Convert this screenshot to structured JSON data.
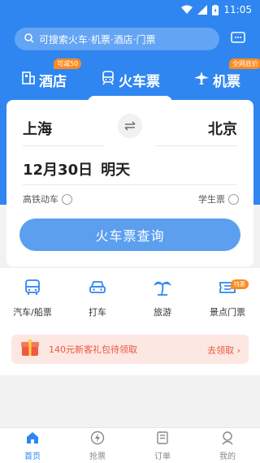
{
  "status": {
    "time": "11:05"
  },
  "search": {
    "placeholder": "可搜索火车·机票·酒店·门票"
  },
  "categories": [
    {
      "label": "酒店",
      "badge": "可减50"
    },
    {
      "label": "火车票"
    },
    {
      "label": "机票",
      "badge": "全网底价"
    }
  ],
  "ticket": {
    "from": "上海",
    "to": "北京",
    "date": "12月30日",
    "day": "明天",
    "option_left": "高铁动车",
    "option_right": "学生票",
    "search_label": "火车票查询"
  },
  "services": [
    {
      "label": "汽车/船票",
      "icon": "bus-icon"
    },
    {
      "label": "打车",
      "icon": "car-icon"
    },
    {
      "label": "旅游",
      "icon": "palm-tree-icon"
    },
    {
      "label": "景点门票",
      "icon": "ticket-icon",
      "badge": "特惠"
    }
  ],
  "promo": {
    "text": "140元新客礼包待领取",
    "link": "去领取"
  },
  "nav": [
    {
      "label": "首页",
      "active": true
    },
    {
      "label": "抢票"
    },
    {
      "label": "订单"
    },
    {
      "label": "我的"
    }
  ],
  "colors": {
    "primary": "#2f86f0",
    "badge": "#ff8a1f",
    "promo": "#e8583d"
  }
}
